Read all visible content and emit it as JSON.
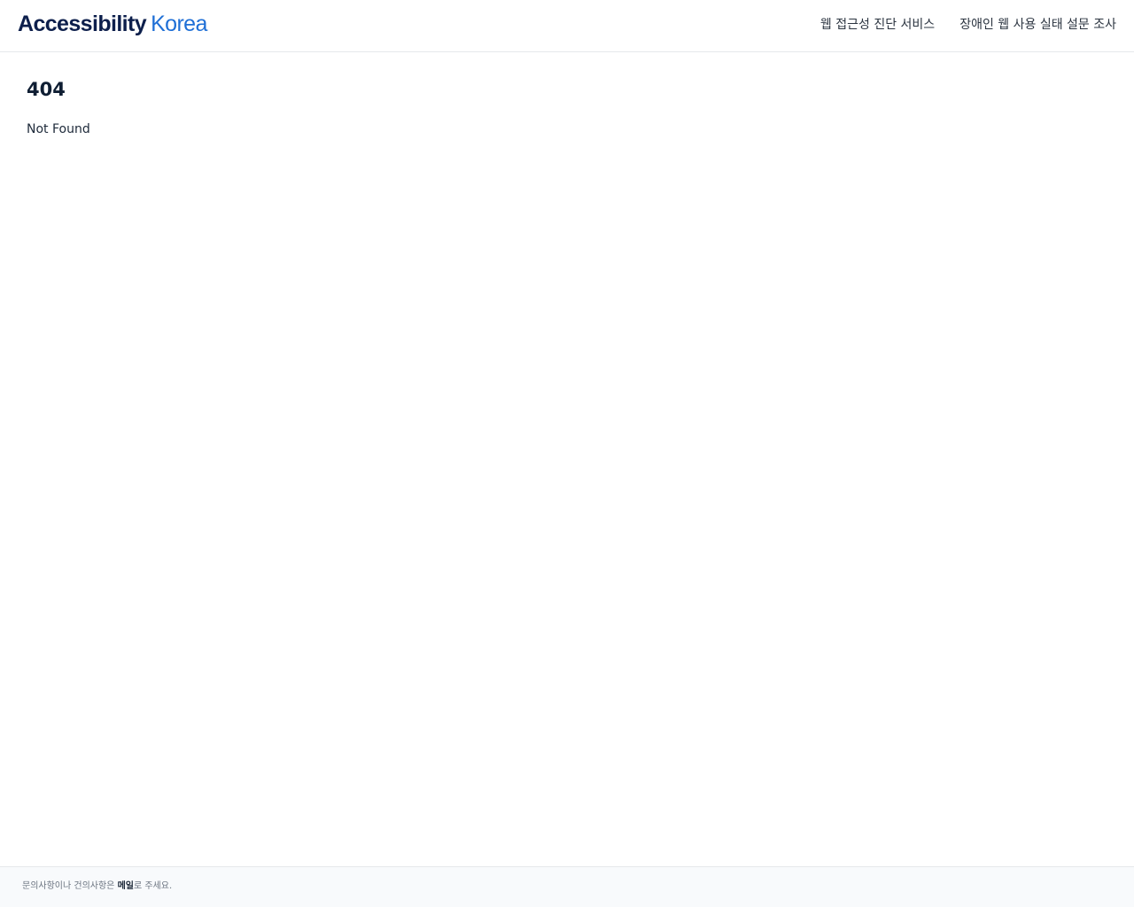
{
  "header": {
    "logo_main": "Accessibility",
    "logo_accent": "Korea",
    "nav": [
      {
        "label": "웹 접근성 진단 서비스"
      },
      {
        "label": "장애인 웹 사용 실태 설문 조사"
      }
    ]
  },
  "main": {
    "code": "404",
    "message": "Not Found"
  },
  "footer": {
    "text_before": "문의사항이나 건의사항은 ",
    "link_label": "메일",
    "text_after": "로 주세요."
  }
}
